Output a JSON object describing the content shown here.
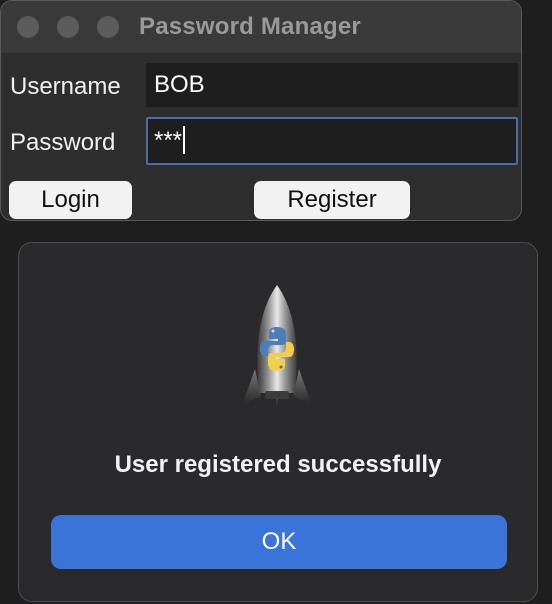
{
  "window": {
    "title": "Password Manager"
  },
  "form": {
    "username_label": "Username",
    "username_value": "BOB",
    "password_label": "Password",
    "password_value": "***",
    "login_label": "Login",
    "register_label": "Register"
  },
  "dialog": {
    "icon": "python-rocket-icon",
    "message": "User registered successfully",
    "ok_label": "OK"
  },
  "colors": {
    "accent": "#3a74d8",
    "focus_ring": "#4a6fa5"
  }
}
